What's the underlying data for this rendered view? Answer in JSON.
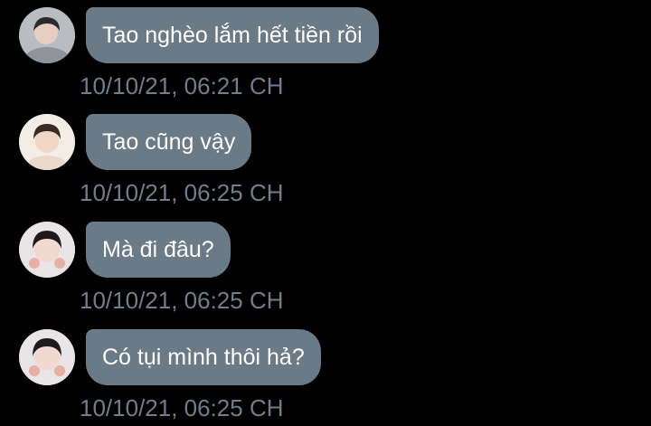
{
  "colors": {
    "background": "#000000",
    "bubble": "#6b7a87",
    "bubble_text": "#ffffff",
    "timestamp": "#6f7e8b"
  },
  "messages": [
    {
      "text": "Tao nghèo lắm hết tiền rồi",
      "timestamp": "10/10/21, 06:21 CH",
      "avatar": "avatar-photo-gray-shirt"
    },
    {
      "text": "Tao cũng vậy",
      "timestamp": "10/10/21, 06:25 CH",
      "avatar": "avatar-photo-light-hair"
    },
    {
      "text": "Mà đi đâu?",
      "timestamp": "10/10/21, 06:25 CH",
      "avatar": "avatar-photo-dark-hair"
    },
    {
      "text": "Có tụi mình thôi hả?",
      "timestamp": "10/10/21, 06:25 CH",
      "avatar": "avatar-photo-dark-hair"
    }
  ]
}
